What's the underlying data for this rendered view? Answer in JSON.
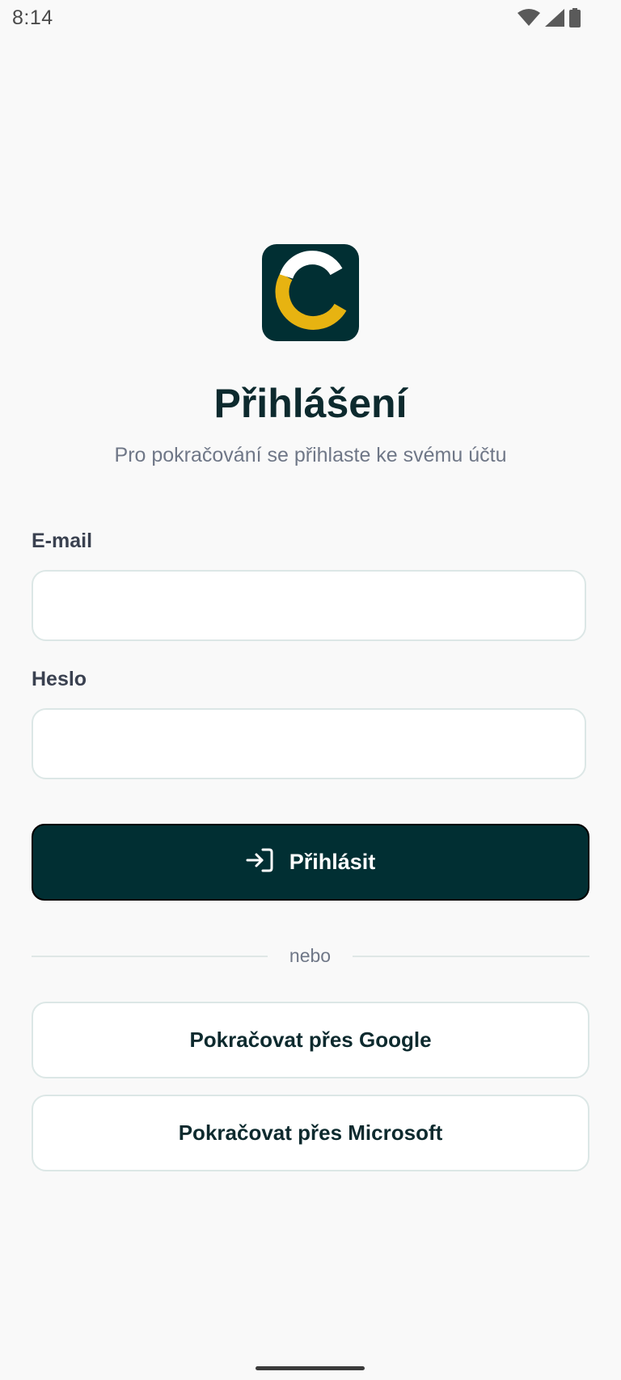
{
  "status_bar": {
    "time": "8:14",
    "icons": [
      "wifi-icon",
      "signal-icon",
      "battery-icon"
    ]
  },
  "logo": {
    "icon": "c-logo-icon",
    "colors": {
      "background": "#012f33",
      "white_arc": "#ffffff",
      "yellow_arc": "#e7b311"
    }
  },
  "header": {
    "title": "Přihlášení",
    "subtitle": "Pro pokračování se přihlaste ke svému účtu"
  },
  "form": {
    "email_label": "E-mail",
    "email_value": "",
    "password_label": "Heslo",
    "password_value": "",
    "login_button_label": "Přihlásit",
    "login_icon": "login-arrow-icon"
  },
  "divider": {
    "text": "nebo"
  },
  "oauth": {
    "google_label": "Pokračovat přes Google",
    "microsoft_label": "Pokračovat přes Microsoft"
  },
  "theme": {
    "primary": "#012f33",
    "accent": "#e7b311",
    "background": "#f9f9f9",
    "muted_text": "#6f7787"
  }
}
